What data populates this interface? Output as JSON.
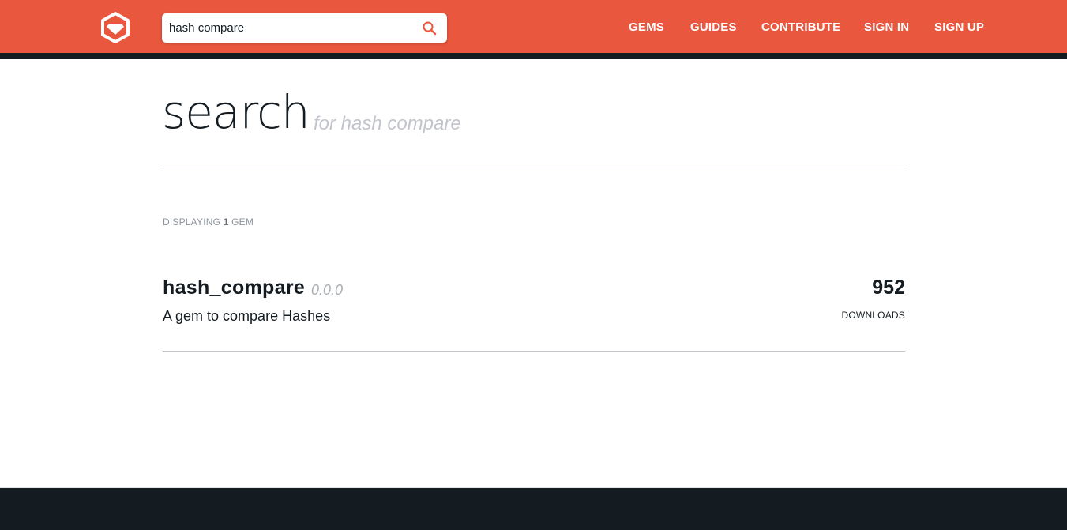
{
  "header": {
    "search": {
      "value": "hash compare",
      "placeholder": ""
    },
    "nav": [
      {
        "label": "GEMS"
      },
      {
        "label": "GUIDES"
      },
      {
        "label": "CONTRIBUTE"
      },
      {
        "label": "SIGN IN"
      },
      {
        "label": "SIGN UP"
      }
    ]
  },
  "main": {
    "title": "search",
    "subtitle": "for hash compare",
    "count": {
      "prefix": "DISPLAYING",
      "number": "1",
      "suffix": "GEM"
    },
    "results": [
      {
        "name": "hash_compare",
        "version": "0.0.0",
        "description": "A gem to compare Hashes",
        "downloads": "952",
        "downloads_label": "DOWNLOADS"
      }
    ]
  },
  "colors": {
    "brand": "#e9573f",
    "dark": "#141c22",
    "muted": "#c1c4ca"
  },
  "icons": {
    "logo": "rubygems-logo-icon",
    "search": "search-icon"
  }
}
